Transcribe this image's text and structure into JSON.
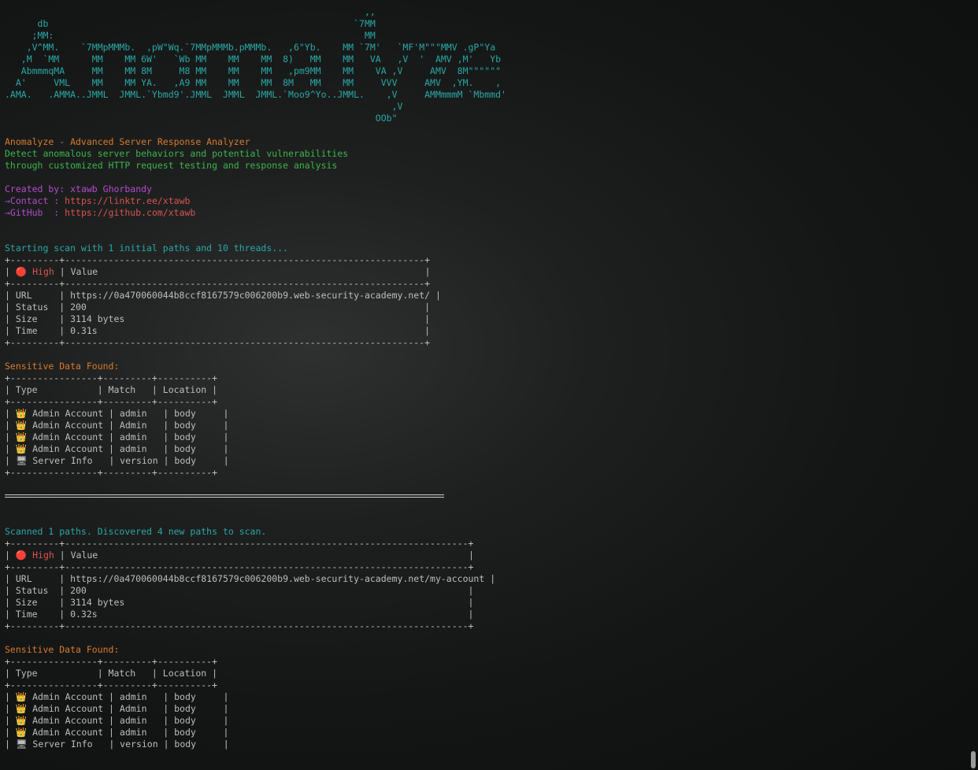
{
  "banner": [
    "                                                                  ,,",
    "      db                                                        `7MM",
    "     ;MM:                                                         MM",
    "    ,V^MM.    `7MMpMMMb.  ,pW\"Wq.`7MMpMMMb.pMMMb.   ,6\"Yb.    MM `7M'   `MF'M\"\"\"MMV .gP\"Ya",
    "   ,M  `MM      MM    MM 6W'   `Wb MM    MM    MM  8)   MM    MM   VA   ,V  '  AMV ,M'   Yb",
    "   AbmmmqMA     MM    MM 8M     M8 MM    MM    MM   ,pm9MM    MM    VA ,V     AMV  8M\"\"\"\"\"\"",
    "  A'     VML    MM    MM YA.   ,A9 MM    MM    MM  8M   MM    MM     VVV     AMV  ,YM.    ,",
    ".AMA.   .AMMA..JMML  JMML.`Ybmd9'.JMML  JMML  JMML.`Moo9^Yo..JMML.    ,V     AMMmmmM `Mbmmd'",
    "                                                                       ,V",
    "                                                                    OOb\""
  ],
  "intro": {
    "title": "Anomalyze - Advanced Server Response Analyzer",
    "desc1": "Detect anomalous server behaviors and potential vulnerabilities",
    "desc2": "through customized HTTP request testing and response analysis",
    "created_label": "Created by:",
    "created_name": "xtawb Ghorbandy",
    "contact_label": "→Contact : ",
    "contact_url": "https://linktr.ee/xtawb",
    "github_label": "→GitHub  : ",
    "github_url": "https://github.com/xtawb"
  },
  "scans": [
    {
      "status_msg": "Starting scan with 1 initial paths and 10 threads...",
      "border": "+---------+------------------------------------------------------------------+",
      "header_pre": "| ",
      "severity": "High",
      "header_post": " | Value                                                            |",
      "rows": [
        "| URL     | https://0a470060044b8ccf8167579c006200b9.web-security-academy.net/ |",
        "| Status  | 200                                                              |",
        "| Size    | 3114 bytes                                                       |",
        "| Time    | 0.31s                                                            |"
      ],
      "sensitive_title": "Sensitive Data Found:",
      "sd_border": "+----------------+---------+----------+",
      "sd_header": "| Type           | Match   | Location |",
      "sd_rows": [
        {
          "icon": "👑",
          "type": "Admin Account",
          "match": "admin",
          "location": "body"
        },
        {
          "icon": "👑",
          "type": "Admin Account",
          "match": "Admin",
          "location": "body"
        },
        {
          "icon": "👑",
          "type": "Admin Account",
          "match": "admin",
          "location": "body"
        },
        {
          "icon": "👑",
          "type": "Admin Account",
          "match": "admin",
          "location": "body"
        },
        {
          "icon": "🖥",
          "type": "Server Info",
          "match": "version",
          "location": "body"
        }
      ]
    },
    {
      "status_msg": "Scanned 1 paths. Discovered 4 new paths to scan.",
      "border": "+---------+--------------------------------------------------------------------------+",
      "header_pre": "| ",
      "severity": "High",
      "header_post": " | Value                                                                    |",
      "rows": [
        "| URL     | https://0a470060044b8ccf8167579c006200b9.web-security-academy.net/my-account |",
        "| Status  | 200                                                                      |",
        "| Size    | 3114 bytes                                                               |",
        "| Time    | 0.32s                                                                    |"
      ],
      "sensitive_title": "Sensitive Data Found:",
      "sd_border": "+----------------+---------+----------+",
      "sd_header": "| Type           | Match   | Location |",
      "sd_rows": [
        {
          "icon": "👑",
          "type": "Admin Account",
          "match": "admin",
          "location": "body"
        },
        {
          "icon": "👑",
          "type": "Admin Account",
          "match": "Admin",
          "location": "body"
        },
        {
          "icon": "👑",
          "type": "Admin Account",
          "match": "admin",
          "location": "body"
        },
        {
          "icon": "👑",
          "type": "Admin Account",
          "match": "admin",
          "location": "body"
        },
        {
          "icon": "🖥",
          "type": "Server Info",
          "match": "version",
          "location": "body"
        }
      ]
    }
  ],
  "severity_icon": "🔴",
  "colors": {
    "banner": "#2aa7a3",
    "title": "#d97a2b",
    "desc": "#3cb54a",
    "credit": "#b34bc9",
    "link": "#d9534f",
    "status": "#2aa7a3"
  }
}
